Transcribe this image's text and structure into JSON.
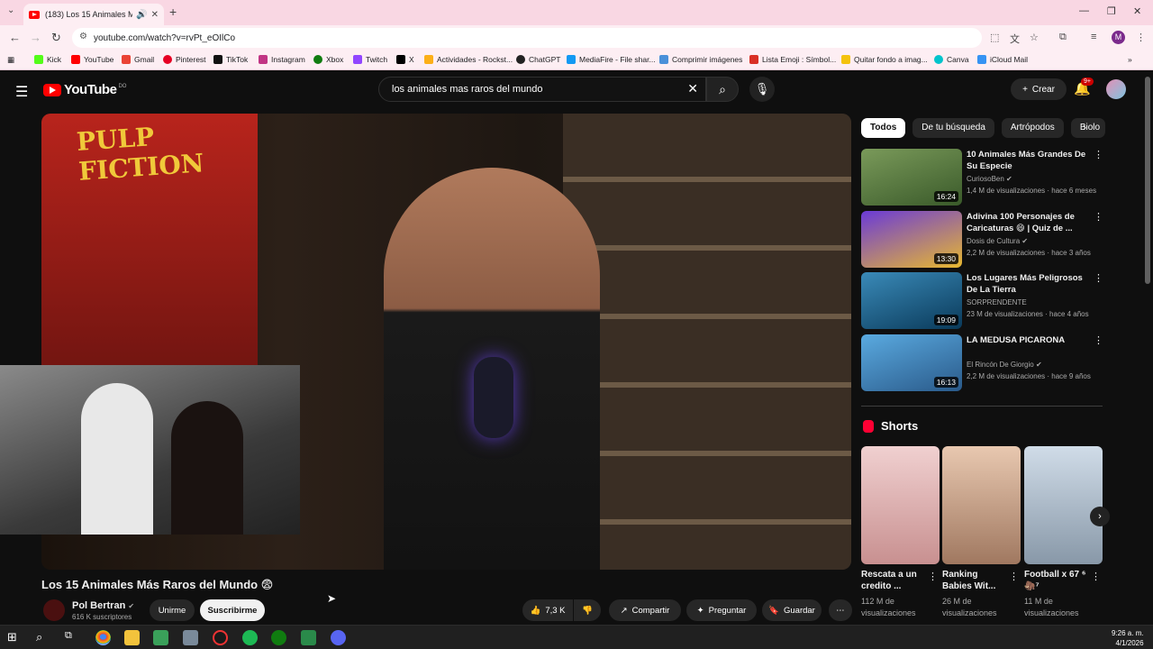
{
  "browser": {
    "tab_title": "(183) Los 15 Animales Más Raros del Mundo",
    "tab_muted_icon": "speaker-icon",
    "url": "youtube.com/watch?v=rvPt_eOIlCo",
    "bookmarks": [
      "Kick",
      "YouTube",
      "Gmail",
      "Pinterest",
      "TikTok",
      "Instagram",
      "Xbox",
      "Twitch",
      "X",
      "Actividades - Rockst...",
      "ChatGPT",
      "MediaFire - File shar...",
      "Comprimir imágenes",
      "Lista Emoji : Símbol...",
      "Quitar fondo a imag...",
      "Canva",
      "iCloud Mail"
    ],
    "profile_initial": "M"
  },
  "header": {
    "logo_text": "YouTube",
    "logo_country": "DO",
    "search_query": "los animales mas raros del mundo",
    "create_label": "Crear",
    "notif_count": "9+"
  },
  "video": {
    "title": "Los 15 Animales Más Raros del Mundo 😨",
    "poster_text": "PULP FICTION",
    "channel": "Pol Bertran",
    "subscribers": "616 K suscriptores",
    "join_label": "Unirme",
    "subscribe_label": "Suscribirme",
    "likes": "7,3 K",
    "share_label": "Compartir",
    "ask_label": "Preguntar",
    "save_label": "Guardar"
  },
  "chips": [
    "Todos",
    "De tu búsqueda",
    "Artrópodos",
    "Biolo"
  ],
  "recommendations": [
    {
      "title": "10 Animales Más Grandes De Su Especie",
      "channel": "CuriosoBen",
      "meta": "1,4 M de visualizaciones · hace 6 meses",
      "duration": "16:24",
      "color": "#5a7a4a"
    },
    {
      "title": "Adivina 100 Personajes de Caricaturas 😄 | Quiz de ...",
      "channel": "Dosis de Cultura",
      "meta": "2,2 M de visualizaciones · hace 3 años",
      "duration": "13:30",
      "color": "#3a5ac8"
    },
    {
      "title": "Los Lugares Más Peligrosos De La Tierra",
      "channel": "SORPRENDENTE",
      "meta": "23 M de visualizaciones · hace 4 años",
      "duration": "19:09",
      "color": "#1a5a7a"
    },
    {
      "title": "LA MEDUSA PICARONA",
      "channel": "El Rincón De Giorgio",
      "meta": "2,2 M de visualizaciones · hace 9 años",
      "duration": "16:13",
      "color": "#4a8ab8"
    }
  ],
  "shorts": {
    "heading": "Shorts",
    "items": [
      {
        "title": "Rescata a un credito ...",
        "views": "112 M de visualizaciones",
        "color": "#d8a8a8"
      },
      {
        "title": "Ranking Babies Wit...",
        "views": "26 M de visualizaciones",
        "color": "#c8a890"
      },
      {
        "title": "Football x 67 ⁶🦣⁷",
        "views": "11 M de visualizaciones",
        "color": "#a8b8c8"
      }
    ]
  },
  "taskbar": {
    "time": "9:26 a. m.",
    "date": "4/1/2026"
  }
}
